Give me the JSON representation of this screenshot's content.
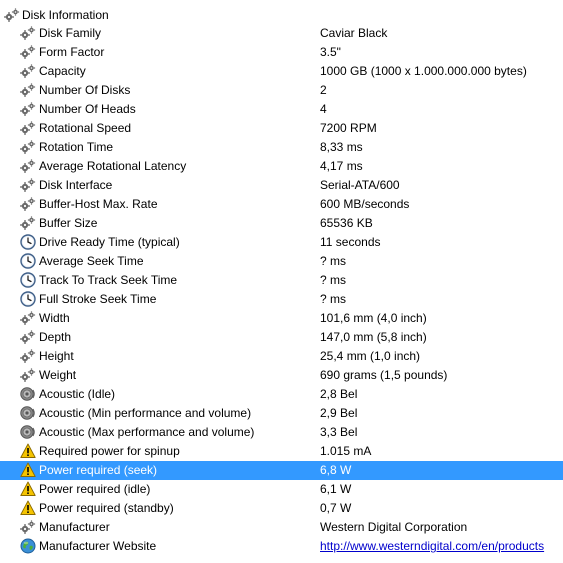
{
  "header": {
    "label": "Disk Information",
    "icon": "gear-icon"
  },
  "rows": [
    {
      "name": "Disk Family",
      "value": "Caviar Black",
      "icon": "gear-icon"
    },
    {
      "name": "Form Factor",
      "value": "3.5\"",
      "icon": "gear-icon"
    },
    {
      "name": "Capacity",
      "value": "1000 GB (1000 x 1.000.000.000 bytes)",
      "icon": "gear-icon"
    },
    {
      "name": "Number Of Disks",
      "value": "2",
      "icon": "gear-icon"
    },
    {
      "name": "Number Of Heads",
      "value": "4",
      "icon": "gear-icon"
    },
    {
      "name": "Rotational Speed",
      "value": "7200 RPM",
      "icon": "gear-icon"
    },
    {
      "name": "Rotation Time",
      "value": "8,33 ms",
      "icon": "gear-icon"
    },
    {
      "name": "Average Rotational Latency",
      "value": "4,17 ms",
      "icon": "gear-icon"
    },
    {
      "name": "Disk Interface",
      "value": "Serial-ATA/600",
      "icon": "gear-icon"
    },
    {
      "name": "Buffer-Host Max. Rate",
      "value": "600 MB/seconds",
      "icon": "gear-icon"
    },
    {
      "name": "Buffer Size",
      "value": "65536 KB",
      "icon": "gear-icon"
    },
    {
      "name": "Drive Ready Time (typical)",
      "value": "11 seconds",
      "icon": "clock-icon"
    },
    {
      "name": "Average Seek Time",
      "value": "? ms",
      "icon": "clock-icon"
    },
    {
      "name": "Track To Track Seek Time",
      "value": "? ms",
      "icon": "clock-icon"
    },
    {
      "name": "Full Stroke Seek Time",
      "value": "? ms",
      "icon": "clock-icon"
    },
    {
      "name": "Width",
      "value": "101,6 mm (4,0 inch)",
      "icon": "gear-icon"
    },
    {
      "name": "Depth",
      "value": "147,0 mm (5,8 inch)",
      "icon": "gear-icon"
    },
    {
      "name": "Height",
      "value": "25,4 mm (1,0 inch)",
      "icon": "gear-icon"
    },
    {
      "name": "Weight",
      "value": "690 grams (1,5 pounds)",
      "icon": "gear-icon"
    },
    {
      "name": "Acoustic (Idle)",
      "value": "2,8 Bel",
      "icon": "speaker-icon"
    },
    {
      "name": "Acoustic (Min performance and volume)",
      "value": "2,9 Bel",
      "icon": "speaker-icon"
    },
    {
      "name": "Acoustic (Max performance and volume)",
      "value": "3,3 Bel",
      "icon": "speaker-icon"
    },
    {
      "name": "Required power for spinup",
      "value": "1.015 mA",
      "icon": "warning-icon"
    },
    {
      "name": "Power required (seek)",
      "value": "6,8 W",
      "icon": "warning-icon",
      "selected": true
    },
    {
      "name": "Power required (idle)",
      "value": "6,1 W",
      "icon": "warning-icon"
    },
    {
      "name": "Power required (standby)",
      "value": "0,7 W",
      "icon": "warning-icon"
    },
    {
      "name": "Manufacturer",
      "value": "Western Digital Corporation",
      "icon": "gear-icon"
    },
    {
      "name": "Manufacturer Website",
      "value": "http://www.westerndigital.com/en/products",
      "icon": "globe-icon",
      "link": true
    }
  ],
  "colors": {
    "selection": "#3399ff",
    "link": "#0000cc",
    "warning": "#f5c400"
  }
}
